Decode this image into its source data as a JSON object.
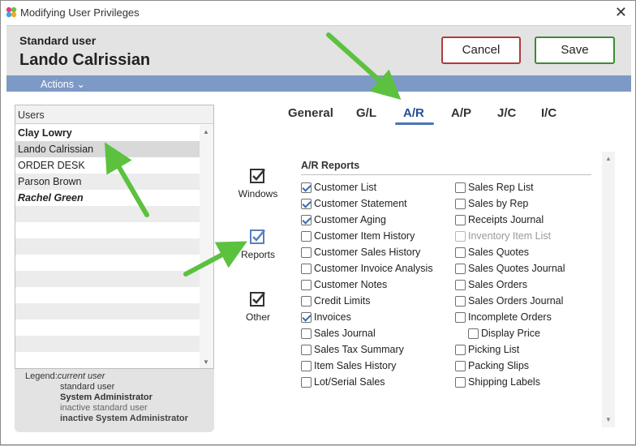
{
  "window": {
    "title": "Modifying User Privileges",
    "close_glyph": "✕"
  },
  "header": {
    "role": "Standard user",
    "username": "Lando Calrissian",
    "cancel_label": "Cancel",
    "save_label": "Save"
  },
  "actions_bar": {
    "actions_label": "Actions ⌄"
  },
  "users": {
    "header": "Users",
    "items": [
      {
        "name": "Clay Lowry",
        "style": "bold"
      },
      {
        "name": "Lando Calrissian",
        "style": "selected"
      },
      {
        "name": "ORDER DESK",
        "style": "normal"
      },
      {
        "name": "Parson Brown",
        "style": "normal"
      },
      {
        "name": "Rachel Green",
        "style": "bold-italic"
      }
    ]
  },
  "legend": {
    "label": "Legend:",
    "current": "current user",
    "standard": "standard user",
    "sysadmin": "System Administrator",
    "inactive_standard": "inactive standard user",
    "inactive_sysadmin": "inactive System Administrator"
  },
  "tabs": [
    {
      "label": "General"
    },
    {
      "label": "G/L"
    },
    {
      "label": "A/R",
      "active": true
    },
    {
      "label": "A/P"
    },
    {
      "label": "J/C"
    },
    {
      "label": "I/C"
    }
  ],
  "categories": {
    "windows": "Windows",
    "reports": "Reports",
    "other": "Other"
  },
  "ar_reports": {
    "title": "A/R Reports",
    "left": [
      {
        "label": "Customer List",
        "checked": true
      },
      {
        "label": "Customer Statement",
        "checked": true
      },
      {
        "label": "Customer Aging",
        "checked": true
      },
      {
        "label": "Customer Item History",
        "checked": false
      },
      {
        "label": "Customer Sales History",
        "checked": false
      },
      {
        "label": "Customer Invoice Analysis",
        "checked": false
      },
      {
        "label": "Customer Notes",
        "checked": false
      },
      {
        "label": "Credit Limits",
        "checked": false
      },
      {
        "label": "Invoices",
        "checked": true
      },
      {
        "label": "Sales Journal",
        "checked": false
      },
      {
        "label": "Sales Tax Summary",
        "checked": false
      },
      {
        "label": "Item Sales History",
        "checked": false
      },
      {
        "label": "Lot/Serial Sales",
        "checked": false
      }
    ],
    "right": [
      {
        "label": "Sales Rep List",
        "checked": false
      },
      {
        "label": "Sales by Rep",
        "checked": false
      },
      {
        "label": "Receipts Journal",
        "checked": false
      },
      {
        "label": "Inventory Item List",
        "checked": false,
        "disabled": true
      },
      {
        "label": "Sales Quotes",
        "checked": false
      },
      {
        "label": "Sales Quotes Journal",
        "checked": false
      },
      {
        "label": "Sales Orders",
        "checked": false
      },
      {
        "label": "Sales Orders Journal",
        "checked": false
      },
      {
        "label": "Incomplete Orders",
        "checked": false
      },
      {
        "label": "Display Price",
        "checked": false,
        "indent": true
      },
      {
        "label": "Picking List",
        "checked": false
      },
      {
        "label": "Packing Slips",
        "checked": false
      },
      {
        "label": "Shipping Labels",
        "checked": false
      }
    ]
  },
  "colors": {
    "accent": "#7d99c5",
    "tab_underline": "#4a74b5",
    "cancel_border": "#b13a3a",
    "save_border": "#3d8a36",
    "arrow": "#5cc13f"
  }
}
